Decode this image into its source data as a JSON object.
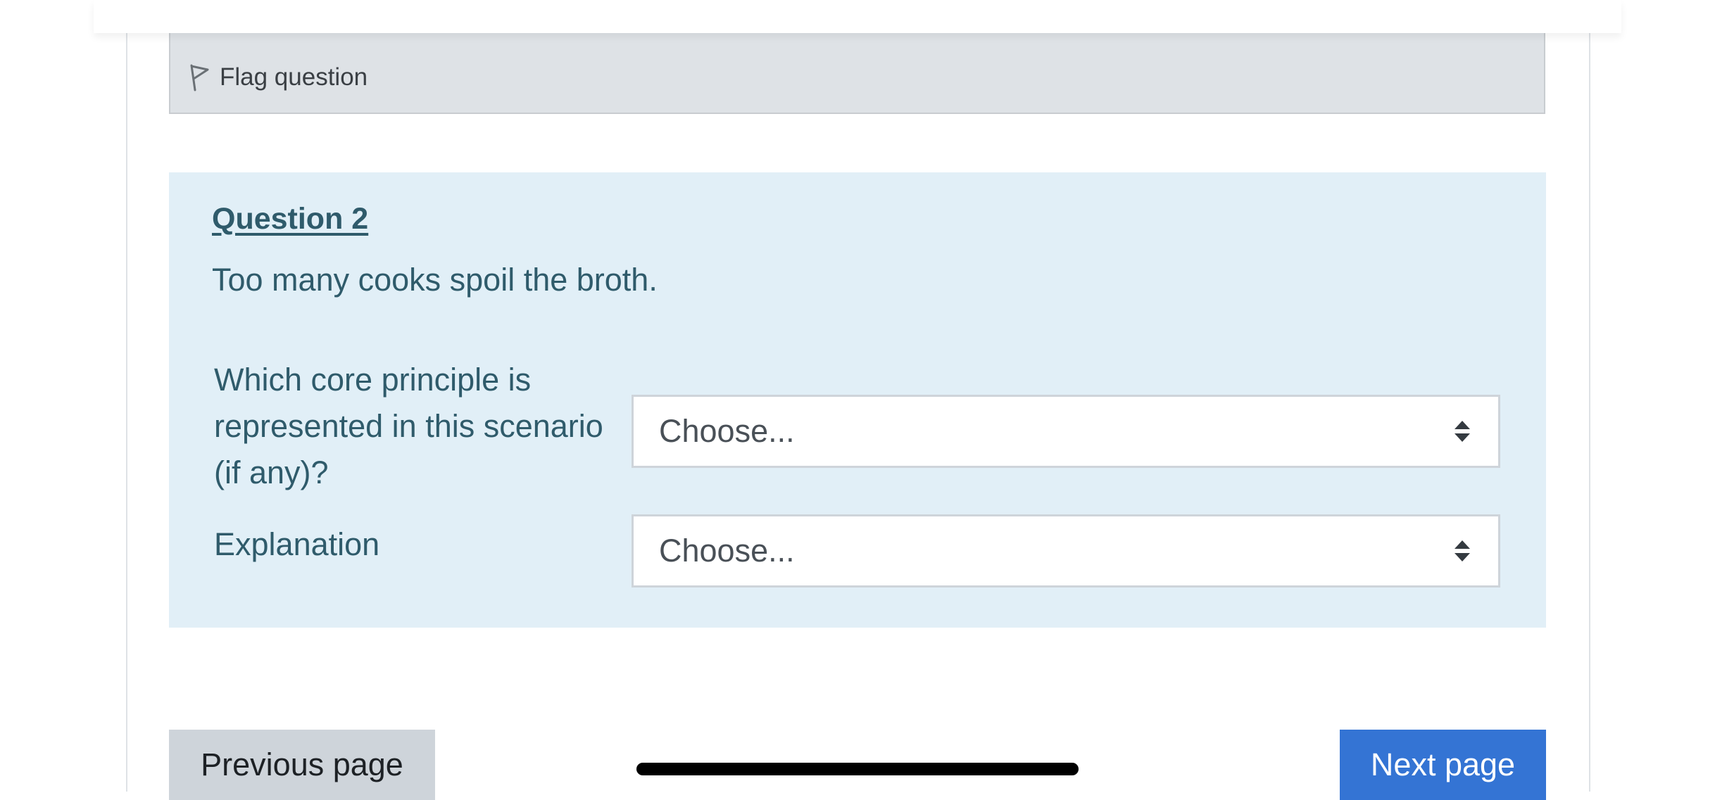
{
  "flag": {
    "label": "Flag question",
    "icon": "flag-icon"
  },
  "question": {
    "title": "Question 2",
    "text": "Too many cooks spoil the broth.",
    "rows": [
      {
        "label": "Which core principle is represented in this scenario (if any)?",
        "selected": "Choose..."
      },
      {
        "label": "Explanation",
        "selected": "Choose..."
      }
    ]
  },
  "navigation": {
    "previous_label": "Previous page",
    "next_label": "Next page"
  },
  "colors": {
    "question_bg": "#e1eff7",
    "question_text": "#2f5b6b",
    "flag_bg": "#dee2e6",
    "next_button": "#3474d4",
    "previous_button": "#ced4da"
  }
}
